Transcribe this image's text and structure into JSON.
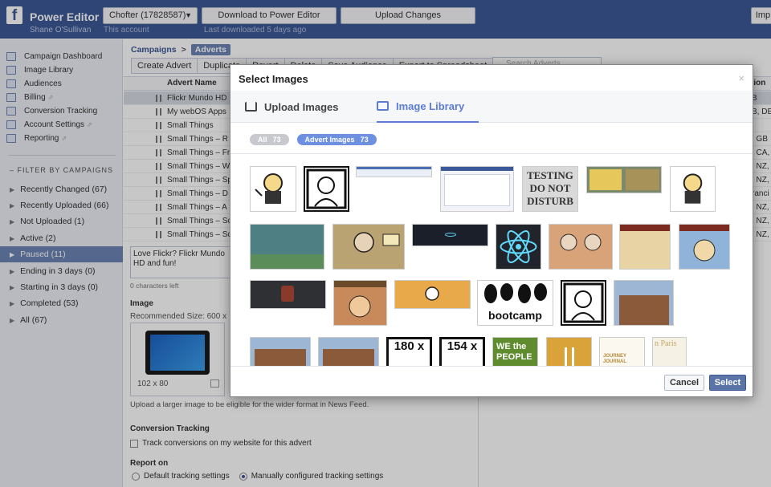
{
  "header": {
    "app_title": "Power Editor",
    "user_name": "Shane O'Sullivan",
    "account_select": "Chofter (17828587)",
    "account_sub": "This account",
    "download_btn": "Download to Power Editor",
    "download_sub": "Last downloaded 5 days ago",
    "upload_btn": "Upload Changes",
    "import_btn": "Imp"
  },
  "sidebar": {
    "nav": [
      {
        "label": "Campaign Dashboard",
        "ext": ""
      },
      {
        "label": "Image Library",
        "ext": ""
      },
      {
        "label": "Audiences",
        "ext": ""
      },
      {
        "label": "Billing",
        "ext": "⇗"
      },
      {
        "label": "Conversion Tracking",
        "ext": ""
      },
      {
        "label": "Account Settings",
        "ext": "⇗"
      },
      {
        "label": "Reporting",
        "ext": "⇗"
      }
    ],
    "filter_heading": "– FILTER BY CAMPAIGNS",
    "filters": [
      "Recently Changed (67)",
      "Recently Uploaded (66)",
      "Not Uploaded (1)",
      "Active (2)",
      "Paused (11)",
      "Ending in 3 days (0)",
      "Starting in 3 days (0)",
      "Completed (53)",
      "All (67)"
    ]
  },
  "main": {
    "breadcrumb_campaigns": "Campaigns",
    "breadcrumb_sep": ">",
    "breadcrumb_adverts": "Adverts",
    "toolbar": [
      "Create Advert",
      "Duplicate",
      "Revert",
      "Delete",
      "Save Audience",
      "Export to Spreadsheet"
    ],
    "search_placeholder": "Search Adverts",
    "col_name": "Advert Name",
    "col_loc": "tion",
    "rows": [
      {
        "name": "Flickr Mundo HD",
        "loc": "B"
      },
      {
        "name": "My webOS Apps",
        "loc": "B, DE"
      },
      {
        "name": "Small Things",
        "loc": ""
      },
      {
        "name": "Small Things – R",
        "loc": ", GB"
      },
      {
        "name": "Small Things – Fr",
        "loc": ", CA,"
      },
      {
        "name": "Small Things – W",
        "loc": ", NZ,"
      },
      {
        "name": "Small Things – Sp",
        "loc": ", NZ,"
      },
      {
        "name": "Small Things – D",
        "loc": "ranci"
      },
      {
        "name": "Small Things – A",
        "loc": ", NZ,"
      },
      {
        "name": "Small Things – Sc",
        "loc": ", NZ,"
      },
      {
        "name": "Small Things – Sc",
        "loc": ", NZ,"
      }
    ],
    "body_text": "Love Flickr? Flickr Mundo HD and fun!",
    "char_left": "0 characters left",
    "image_label": "Image",
    "recommended": "Recommended Size: 600 x",
    "image_size": "102 x 80",
    "larger_note": "Upload a larger image to be eligible for the wider format in News Feed.",
    "conversion_label": "Conversion Tracking",
    "track_label": "Track conversions on my website for this advert",
    "report_label": "Report on",
    "radio_default": "Default tracking settings",
    "radio_manual": "Manually configured tracking settings"
  },
  "modal": {
    "title": "Select Images",
    "close": "×",
    "tab_upload": "Upload Images",
    "tab_library": "Image Library",
    "pill_all": "All",
    "pill_all_count": "73",
    "pill_advert": "Advert Images",
    "pill_advert_count": "73",
    "thumb_testing": "TESTING DO NOT DISTURB",
    "thumb_bootcamp": "bootcamp",
    "thumb_180": "180 x",
    "thumb_154": "154 x",
    "thumb_people": "WE the PEOPLE",
    "thumb_paris": "n Paris",
    "thumb_journey": "JOURNEY JOURNAL",
    "cancel": "Cancel",
    "select": "Select"
  },
  "colors": {
    "brand": "#3b5998",
    "accent": "#6d84b4",
    "tab_active": "#5b7bd5",
    "pill_grey": "#c7c9ce",
    "pill_blue": "#6d90e0"
  }
}
